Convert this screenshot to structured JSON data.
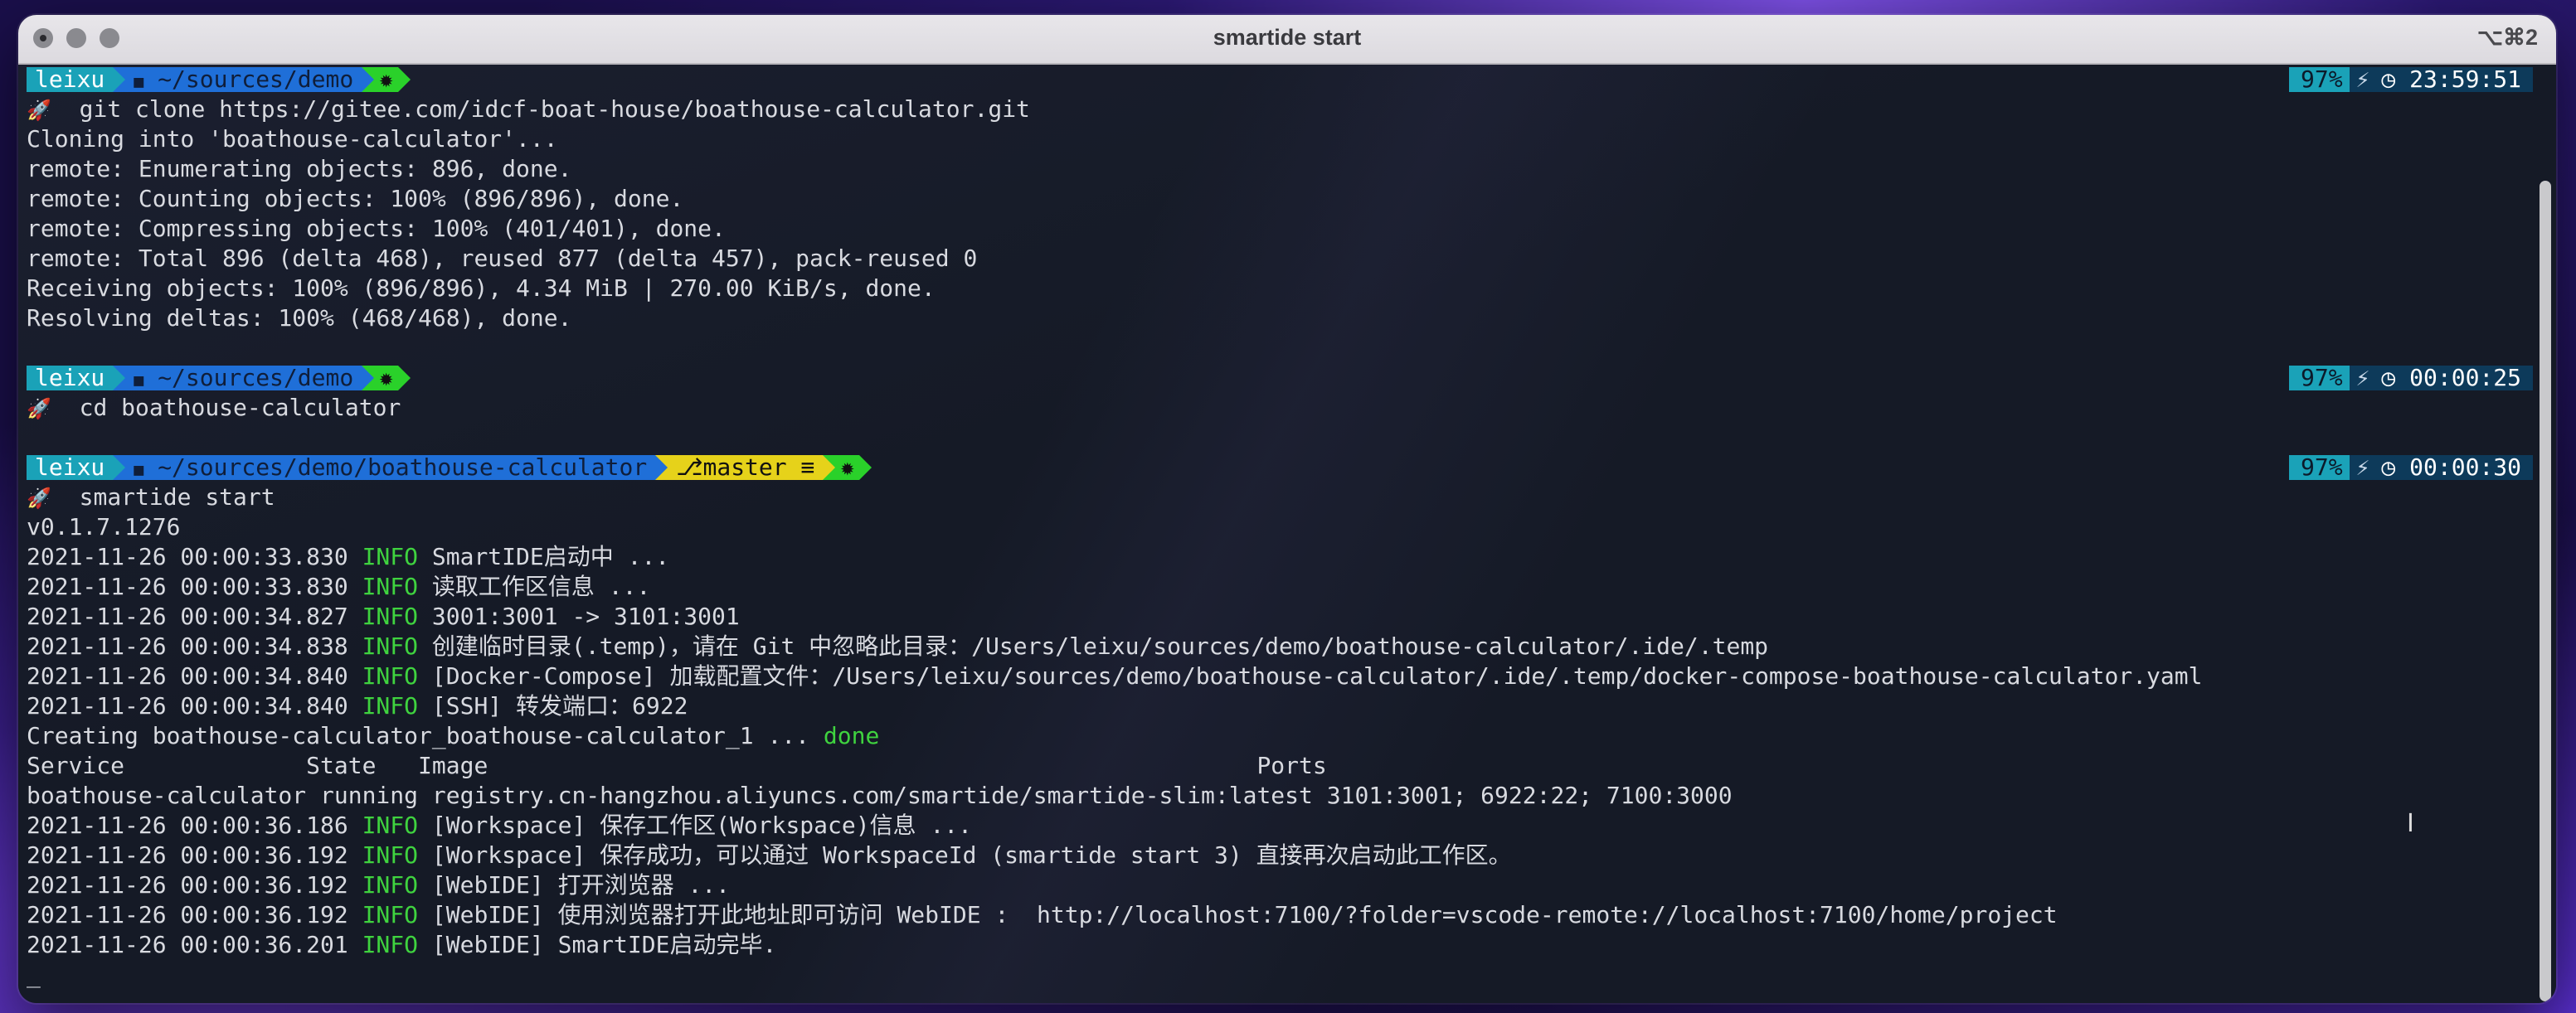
{
  "window": {
    "title": "smartide start",
    "shortcut": "⌥⌘2"
  },
  "prompts": [
    {
      "user": "leixu",
      "path": "~/sources/demo",
      "battery": "97%",
      "time": "23:59:51",
      "command": "git clone https://gitee.com/idcf-boat-house/boathouse-calculator.git"
    },
    {
      "user": "leixu",
      "path": "~/sources/demo",
      "battery": "97%",
      "time": "00:00:25",
      "command": "cd boathouse-calculator"
    },
    {
      "user": "leixu",
      "path": "~/sources/demo/boathouse-calculator",
      "git": "master ≡",
      "battery": "97%",
      "time": "00:00:30",
      "command": "smartide start"
    }
  ],
  "clone_output": [
    "Cloning into 'boathouse-calculator'...",
    "remote: Enumerating objects: 896, done.",
    "remote: Counting objects: 100% (896/896), done.",
    "remote: Compressing objects: 100% (401/401), done.",
    "remote: Total 896 (delta 468), reused 877 (delta 457), pack-reused 0",
    "Receiving objects: 100% (896/896), 4.34 MiB | 270.00 KiB/s, done.",
    "Resolving deltas: 100% (468/468), done."
  ],
  "version": "v0.1.7.1276",
  "level": "INFO",
  "log1": [
    {
      "ts": "2021-11-26 00:00:33.830",
      "msg": " SmartIDE启动中 ..."
    },
    {
      "ts": "2021-11-26 00:00:33.830",
      "msg": " 读取工作区信息 ..."
    },
    {
      "ts": "2021-11-26 00:00:34.827",
      "msg": " 3001:3001 -> 3101:3001"
    },
    {
      "ts": "2021-11-26 00:00:34.838",
      "msg": " 创建临时目录(.temp)，请在 Git 中忽略此目录：/Users/leixu/sources/demo/boathouse-calculator/.ide/.temp"
    },
    {
      "ts": "2021-11-26 00:00:34.840",
      "msg": " [Docker-Compose] 加载配置文件：/Users/leixu/sources/demo/boathouse-calculator/.ide/.temp/docker-compose-boathouse-calculator.yaml"
    },
    {
      "ts": "2021-11-26 00:00:34.840",
      "msg": " [SSH] 转发端口：6922"
    }
  ],
  "creating": {
    "text": "Creating boathouse-calculator_boathouse-calculator_1 ... ",
    "status": "done"
  },
  "table": {
    "header": "Service             State   Image                                                       Ports",
    "row": "boathouse-calculator running registry.cn-hangzhou.aliyuncs.com/smartide/smartide-slim:latest 3101:3001; 6922:22; 7100:3000"
  },
  "log2": [
    {
      "ts": "2021-11-26 00:00:36.186",
      "msg": " [Workspace] 保存工作区(Workspace)信息 ..."
    },
    {
      "ts": "2021-11-26 00:00:36.192",
      "msg": " [Workspace] 保存成功，可以通过 WorkspaceId (smartide start 3) 直接再次启动此工作区。"
    },
    {
      "ts": "2021-11-26 00:00:36.192",
      "msg": " [WebIDE] 打开浏览器 ..."
    },
    {
      "ts": "2021-11-26 00:00:36.192",
      "msg": " [WebIDE] 使用浏览器打开此地址即可访问 WebIDE :  http://localhost:7100/?folder=vscode-remote://localhost:7100/home/project"
    },
    {
      "ts": "2021-11-26 00:00:36.201",
      "msg": " [WebIDE] SmartIDE启动完毕."
    }
  ],
  "icons": {
    "apple": "apple-icon",
    "folder": "folder-icon",
    "bug": "bug-icon",
    "rocket": "rocket-icon",
    "clock": "clock-icon",
    "plug": "plug-icon",
    "branch": "branch-icon"
  }
}
